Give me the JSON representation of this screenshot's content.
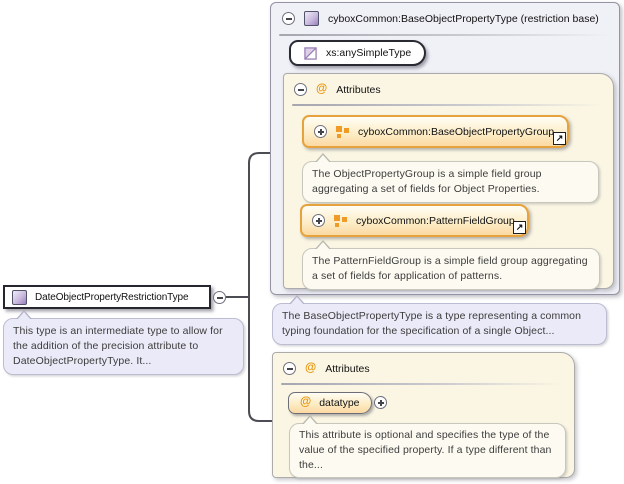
{
  "base_panel": {
    "title": "cyboxCommon:BaseObjectPropertyType (restriction base)",
    "base_type_badge": "xs:anySimpleType",
    "attributes": {
      "header": "Attributes",
      "groups": [
        {
          "label": "cyboxCommon:BaseObjectPropertyGroup",
          "annotation": "The ObjectPropertyGroup is a simple field group aggregating a set of fields for Object Properties."
        },
        {
          "label": "cyboxCommon:PatternFieldGroup",
          "annotation": "The PatternFieldGroup is a simple field group aggregating a set of fields for application of patterns."
        }
      ]
    },
    "annotation": "The BaseObjectPropertyType is a type representing a common typing foundation for the specification of a single Object..."
  },
  "main_type": {
    "label": "DateObjectPropertyRestrictionType",
    "annotation": "This type is an intermediate type to allow for the addition of the precision attribute to DateObjectPropertyType. It..."
  },
  "attributes_panel": {
    "header": "Attributes",
    "attribute": "datatype",
    "annotation": "This attribute is optional and specifies the type of the value of the specified property. If a type different than the..."
  },
  "glyphs": {
    "at": "@",
    "link_arrow": "↗"
  },
  "colors": {
    "panel_bg": "#f0f0f7",
    "panel_border": "#9494a4",
    "section_bg": "#fbf6e3",
    "section_border": "#ababab",
    "group_border": "#e6a23c",
    "group_gradient_bottom": "#fbd9a2",
    "note_cream_bg": "#fdfbf1",
    "note_purple_bg": "#eaeaf8",
    "accent_at": "#e8940a",
    "type_icon_purple": "#9b7fc0",
    "connector": "#4c4c55"
  }
}
